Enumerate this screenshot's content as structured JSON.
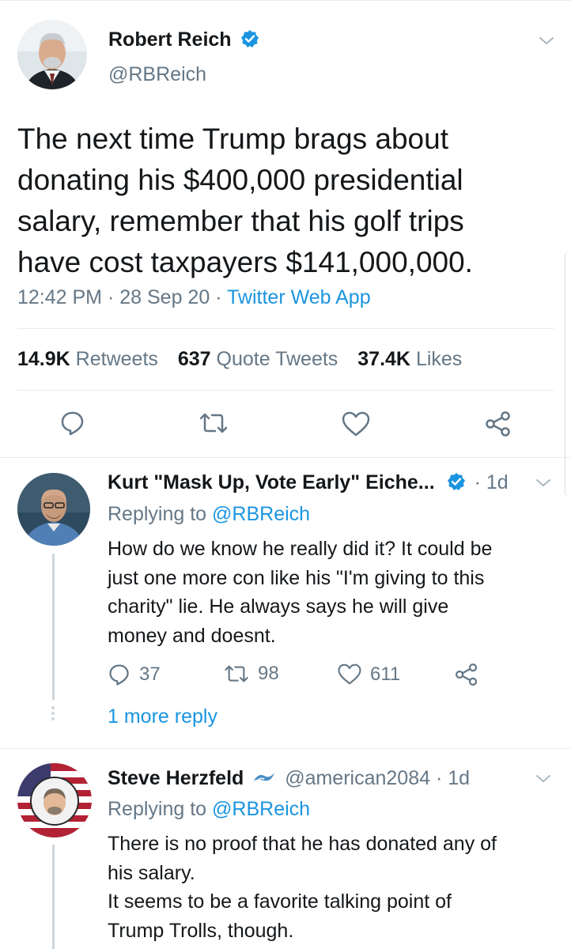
{
  "main_tweet": {
    "author_name": "Robert Reich",
    "handle": "@RBReich",
    "text_lines": [
      "The next time Trump brags about",
      "donating his $400,000 presidential",
      "salary, remember that his golf trips",
      "have cost taxpayers $141,000,000."
    ],
    "time": "12:42 PM",
    "sep": "·",
    "date": "28 Sep 20",
    "source": "Twitter Web App",
    "stats": {
      "retweets_count": "14.9K",
      "retweets_label": "Retweets",
      "quotes_count": "637",
      "quotes_label": "Quote Tweets",
      "likes_count": "37.4K",
      "likes_label": "Likes"
    }
  },
  "replies": [
    {
      "author_name": "Kurt \"Mask Up, Vote Early\" Eiche...",
      "time": "· 1d",
      "replying_prefix": "Replying to",
      "replying_handle": "@RBReich",
      "text_lines": [
        "How do we know he really did it? It could be",
        "just one more con like his \"I'm giving to this",
        "charity\" lie. He always says he will give",
        "money and doesnt."
      ],
      "reply_count": "37",
      "retweet_count": "98",
      "like_count": "611",
      "more_replies": "1 more reply"
    },
    {
      "author_name": "Steve Herzfeld",
      "handle_time": "@american2084 · 1d",
      "replying_prefix": "Replying to",
      "replying_handle": "@RBReich",
      "text_lines": [
        "There is no proof that he has donated any of",
        "his salary.",
        "It seems to be a favorite talking point of",
        "Trump Trolls, though."
      ]
    }
  ],
  "colors": {
    "accent": "#1b95e0",
    "text": "#14171a",
    "secondary": "#657786",
    "divider": "#e6ecf0"
  }
}
